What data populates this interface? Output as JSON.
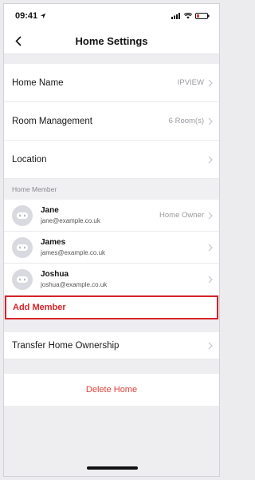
{
  "status_bar": {
    "time": "09:41"
  },
  "nav": {
    "title": "Home Settings"
  },
  "settings": [
    {
      "label": "Home Name",
      "value": "IPVIEW"
    },
    {
      "label": "Room Management",
      "value": "6 Room(s)"
    },
    {
      "label": "Location",
      "value": ""
    }
  ],
  "members_header": "Home Member",
  "members": [
    {
      "name": "Jane",
      "email": "jane@example.co.uk",
      "role": "Home Owner"
    },
    {
      "name": "James",
      "email": "james@example.co.uk",
      "role": ""
    },
    {
      "name": "Joshua",
      "email": "joshua@example.co.uk",
      "role": ""
    }
  ],
  "add_member_label": "Add Member",
  "transfer_label": "Transfer Home Ownership",
  "delete_label": "Delete Home",
  "colors": {
    "accent": "#d8232a",
    "danger_text": "#e0413a"
  }
}
